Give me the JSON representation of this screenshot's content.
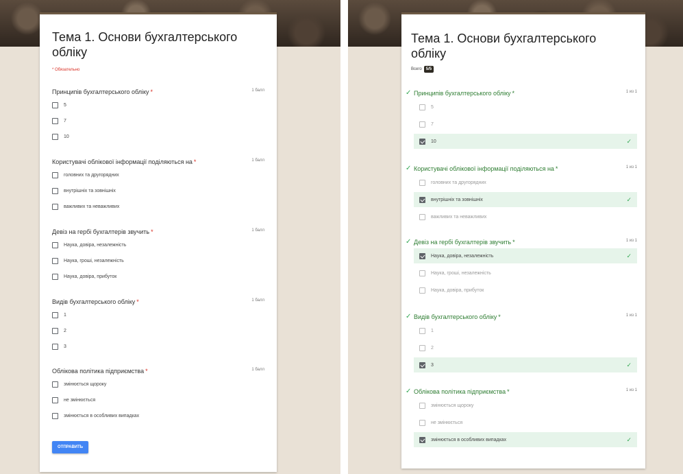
{
  "left": {
    "title": "Тема 1. Основи бухгалтерського обліку",
    "required_note": "* Обязательно",
    "submit_label": "ОТПРАВИТЬ",
    "questions": [
      {
        "title": "Принципів бухгалтерського обліку",
        "star": "*",
        "points": "1 балл",
        "options": [
          {
            "label": "5"
          },
          {
            "label": "7"
          },
          {
            "label": "10"
          }
        ]
      },
      {
        "title": "Користувачі облікової інформації поділяються на",
        "star": "*",
        "points": "1 балл",
        "options": [
          {
            "label": "головних та другорядних"
          },
          {
            "label": "внутрішніх та зовнішніх"
          },
          {
            "label": "важливих та неважливих"
          }
        ]
      },
      {
        "title": "Девіз на гербі бухгалтерів звучить",
        "star": "*",
        "points": "1 балл",
        "options": [
          {
            "label": "Наука, довіра, незалежність"
          },
          {
            "label": "Наука, гроші, незалежність"
          },
          {
            "label": "Наука, довіра, прибуток"
          }
        ]
      },
      {
        "title": "Видів бухгалтерського обліку",
        "star": "*",
        "points": "1 балл",
        "options": [
          {
            "label": "1"
          },
          {
            "label": "2"
          },
          {
            "label": "3"
          }
        ]
      },
      {
        "title": "Облікова політика підприємства",
        "star": "*",
        "points": "1 балл",
        "options": [
          {
            "label": "змінюється щороку"
          },
          {
            "label": "не змінюється"
          },
          {
            "label": "змінюється в особливих випадках"
          }
        ]
      }
    ]
  },
  "right": {
    "title": "Тема 1. Основи бухгалтерського обліку",
    "score_label": "Всего",
    "score_value": "5/5",
    "questions": [
      {
        "title": "Принципів бухгалтерського обліку",
        "star": "*",
        "points": "1 из 1",
        "correct_index": 2,
        "options": [
          {
            "label": "5"
          },
          {
            "label": "7"
          },
          {
            "label": "10"
          }
        ]
      },
      {
        "title": "Користувачі облікової інформації поділяються на",
        "star": "*",
        "points": "1 из 1",
        "correct_index": 1,
        "options": [
          {
            "label": "головних та другорядних"
          },
          {
            "label": "внутрішніх та зовнішніх"
          },
          {
            "label": "важливих та неважливих"
          }
        ]
      },
      {
        "title": "Девіз на гербі бухгалтерів звучить",
        "star": "*",
        "points": "1 из 1",
        "correct_index": 0,
        "options": [
          {
            "label": "Наука, довіра, незалежність"
          },
          {
            "label": "Наука, гроші, незалежність"
          },
          {
            "label": "Наука, довіра, прибуток"
          }
        ]
      },
      {
        "title": "Видів бухгалтерського обліку",
        "star": "*",
        "points": "1 из 1",
        "correct_index": 2,
        "options": [
          {
            "label": "1"
          },
          {
            "label": "2"
          },
          {
            "label": "3"
          }
        ]
      },
      {
        "title": "Облікова політика підприємства",
        "star": "*",
        "points": "1 из 1",
        "correct_index": 2,
        "options": [
          {
            "label": "змінюється щороку"
          },
          {
            "label": "не змінюється"
          },
          {
            "label": "змінюється в особливих випадках"
          }
        ]
      }
    ],
    "icons": {
      "question_correct": "check-icon",
      "option_correct": "check-icon"
    },
    "colors": {
      "correct_green": "#34a853",
      "correct_bg": "#e6f4ea",
      "submit_blue": "#4285f4"
    }
  }
}
